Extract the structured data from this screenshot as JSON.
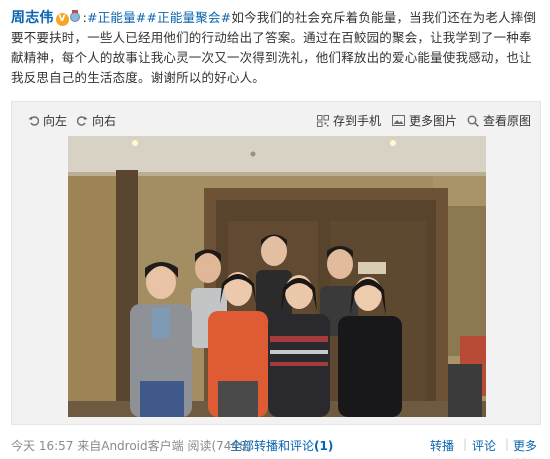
{
  "post": {
    "author": "周志伟",
    "verified_mark": "V",
    "text_lines": [
      {
        "prefix": ":",
        "topics": [
          "#正能量#",
          "#正能量聚会#"
        ],
        "rest": "如今我们的社会充斥着负能量，当我们还在为老人摔倒"
      },
      {
        "text": "要不要扶时，一些人已经用他们的行动给出了答案。通过在百鮫园的聚会，让我学到了一种奉"
      },
      {
        "text": "献精神，每个人的故事让我心灵一次又一次得到洗礼，他们释放出的爱心能量使我感动，也让"
      },
      {
        "text": "我反思自己的生活态度。谢谢所以的好心人。"
      }
    ]
  },
  "media_toolbar": {
    "rotate_left": "向左",
    "rotate_right": "向右",
    "save_to_phone": "存到手机",
    "more_pictures": "更多图片",
    "view_original": "查看原图"
  },
  "footer": {
    "time": "今天 16:57",
    "source": "来自Android客户端",
    "reads_label": "阅读",
    "reads_count": "(7448)",
    "all_reposts_label": "全部转播和评论",
    "all_reposts_count": "(1)",
    "repost": "转播",
    "comment": "评论",
    "more": "更多"
  },
  "colors": {
    "link_blue": "#0a65b1",
    "text": "#333333",
    "meta_gray": "#8a8a8a"
  }
}
